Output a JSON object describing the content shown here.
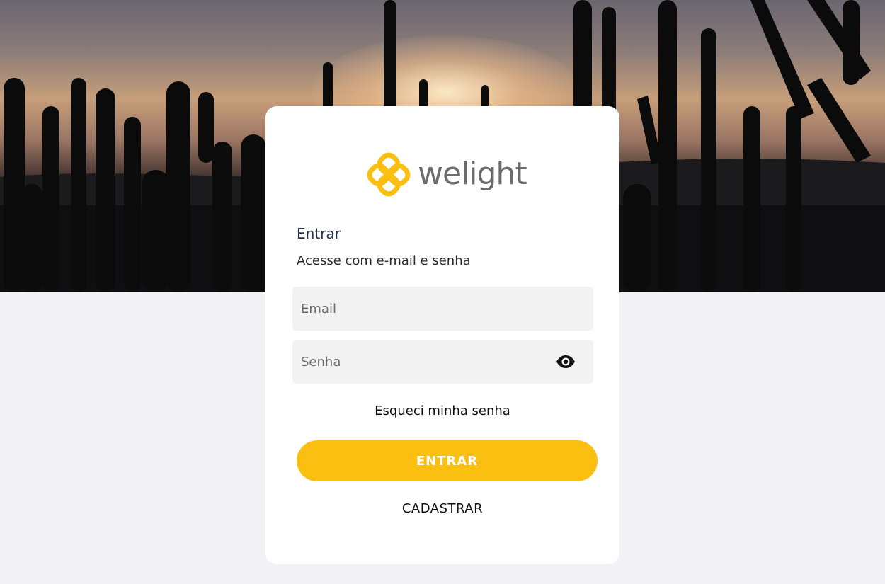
{
  "brand": {
    "name": "welight",
    "accent": "#fbbf12",
    "text_color": "#6b6b6b"
  },
  "login": {
    "title": "Entrar",
    "subtitle": "Acesse com e-mail e senha",
    "email_placeholder": "Email",
    "password_placeholder": "Senha",
    "show_password_icon": "eye-icon",
    "forgot_label": "Esqueci minha senha",
    "submit_label": "ENTRAR",
    "register_label": "CADASTRAR"
  },
  "colors": {
    "background": "#f2f2f7",
    "card": "#ffffff",
    "field": "#f2f2f2",
    "button": "#fbbf12"
  }
}
